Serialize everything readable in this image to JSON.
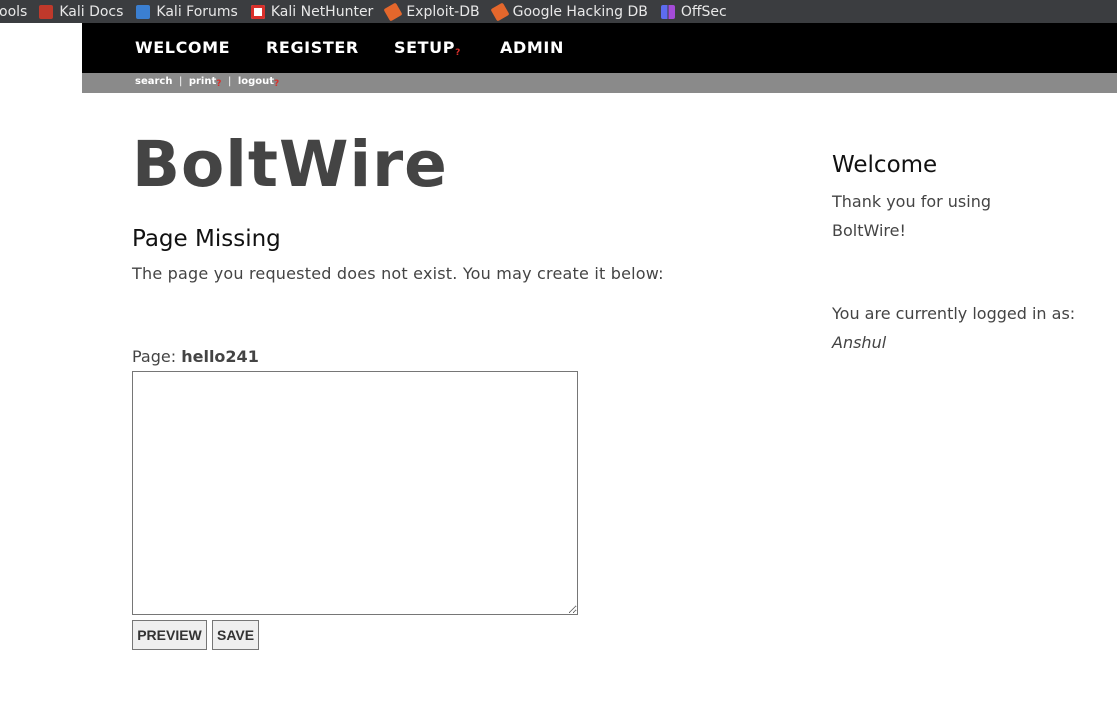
{
  "bookmarks": [
    {
      "label": "ools",
      "icon": "none"
    },
    {
      "label": "Kali Docs",
      "icon": "kali-docs-icon"
    },
    {
      "label": "Kali Forums",
      "icon": "kali-forums-icon"
    },
    {
      "label": "Kali NetHunter",
      "icon": "kali-nethunter-icon"
    },
    {
      "label": "Exploit-DB",
      "icon": "exploit-db-icon"
    },
    {
      "label": "Google Hacking DB",
      "icon": "ghdb-icon"
    },
    {
      "label": "OffSec",
      "icon": "offsec-icon"
    }
  ],
  "nav": {
    "welcome": "WELCOME",
    "register": "REGISTER",
    "setup": "SETUP",
    "setup_marker": "?",
    "admin": "ADMIN"
  },
  "subnav": {
    "search": "search",
    "separator": "|",
    "print": "print",
    "print_marker": "?",
    "logout": "logout",
    "logout_marker": "?"
  },
  "site_title": "BoltWire",
  "page": {
    "heading": "Page Missing",
    "message": "The page you requested does not exist. You may create it below:",
    "label": "Page:",
    "name": "hello241",
    "editor_value": ""
  },
  "buttons": {
    "preview": "PREVIEW",
    "save": "SAVE"
  },
  "sidebar": {
    "title": "Welcome",
    "thanks": "Thank you for using BoltWire!",
    "login_text": "You are currently logged in as:",
    "username": "Anshul"
  },
  "colors": {
    "nav_bg": "#000000",
    "subnav_bg": "#8a8a8a",
    "marker": "#d9302b",
    "bookmarks_bg": "#3b3d40"
  }
}
